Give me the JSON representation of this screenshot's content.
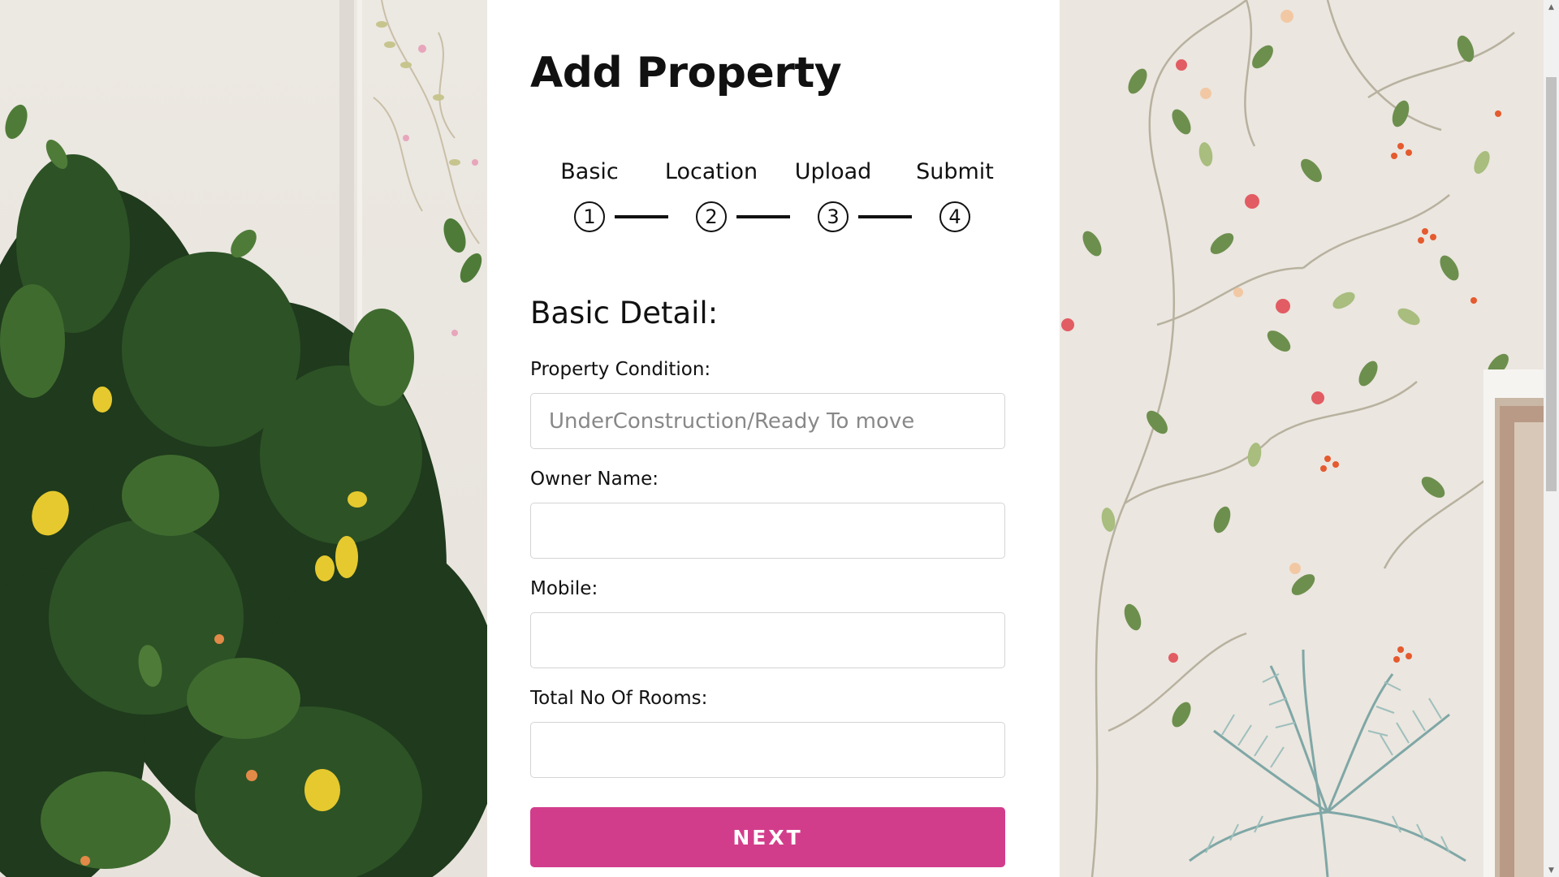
{
  "form": {
    "title": "Add Property",
    "steps": [
      {
        "label": "Basic",
        "number": "1"
      },
      {
        "label": "Location",
        "number": "2"
      },
      {
        "label": "Upload",
        "number": "3"
      },
      {
        "label": "Submit",
        "number": "4"
      }
    ],
    "section_title": "Basic Detail:",
    "fields": {
      "property_condition": {
        "label": "Property Condition:",
        "placeholder": "UnderConstruction/Ready To move",
        "value": ""
      },
      "owner_name": {
        "label": "Owner Name:",
        "placeholder": "",
        "value": ""
      },
      "mobile": {
        "label": "Mobile:",
        "placeholder": "",
        "value": ""
      },
      "total_rooms": {
        "label": "Total No Of Rooms:",
        "placeholder": "",
        "value": ""
      }
    },
    "next_label": "NEXT"
  },
  "colors": {
    "accent": "#d23d8b",
    "card_background": "#ffffff",
    "text": "#111111",
    "input_border": "#d4d4d4",
    "placeholder": "#888888"
  },
  "icons": {
    "scroll_up": "triangle-up-icon",
    "scroll_down": "triangle-down-icon"
  }
}
